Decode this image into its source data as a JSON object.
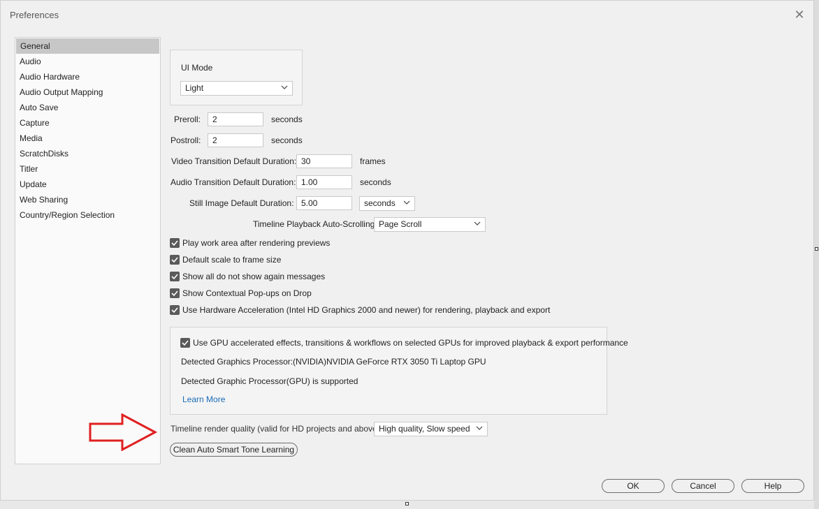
{
  "window": {
    "title": "Preferences",
    "close_glyph": "✕"
  },
  "sidebar": {
    "items": [
      {
        "label": "General",
        "selected": true
      },
      {
        "label": "Audio"
      },
      {
        "label": "Audio Hardware"
      },
      {
        "label": "Audio Output Mapping"
      },
      {
        "label": "Auto Save"
      },
      {
        "label": "Capture"
      },
      {
        "label": "Media"
      },
      {
        "label": "ScratchDisks"
      },
      {
        "label": "Titler"
      },
      {
        "label": "Update"
      },
      {
        "label": "Web Sharing"
      },
      {
        "label": "Country/Region Selection"
      }
    ]
  },
  "general": {
    "ui_mode": {
      "label": "UI Mode",
      "value": "Light"
    },
    "preroll": {
      "label": "Preroll:",
      "value": "2",
      "unit": "seconds"
    },
    "postroll": {
      "label": "Postroll:",
      "value": "2",
      "unit": "seconds"
    },
    "video_transition": {
      "label": "Video Transition Default Duration:",
      "value": "30",
      "unit": "frames"
    },
    "audio_transition": {
      "label": "Audio Transition Default Duration:",
      "value": "1.00",
      "unit": "seconds"
    },
    "still_image": {
      "label": "Still Image Default Duration:",
      "value": "5.00",
      "unit": "seconds"
    },
    "timeline_scroll": {
      "label": "Timeline Playback Auto-Scrolling:",
      "value": "Page Scroll"
    },
    "checkboxes": [
      {
        "label": "Play work area after rendering previews",
        "checked": true
      },
      {
        "label": "Default scale to frame size",
        "checked": true
      },
      {
        "label": "Show all do not show again messages",
        "checked": true
      },
      {
        "label": "Show Contextual Pop-ups on Drop",
        "checked": true
      },
      {
        "label": "Use Hardware Acceleration (Intel HD Graphics 2000 and newer) for rendering, playback and export",
        "checked": true
      }
    ],
    "gpu": {
      "checkbox_label": "Use GPU accelerated effects, transitions & workflows on selected GPUs for improved playback & export performance",
      "checked": true,
      "detected_label": "Detected Graphics Processor:",
      "detected_value": "(NVIDIA)NVIDIA GeForce RTX 3050 Ti Laptop GPU",
      "supported_text": "Detected Graphic Processor(GPU) is supported",
      "learn_more": "Learn More"
    },
    "render_quality": {
      "label": "Timeline render quality (valid for HD projects and above):",
      "value": "High quality, Slow speed"
    },
    "clean_button": "Clean Auto Smart Tone Learning"
  },
  "footer": {
    "ok": "OK",
    "cancel": "Cancel",
    "help": "Help"
  },
  "colors": {
    "arrow": "#e02020",
    "link": "#1a6bb8"
  },
  "icons": {
    "checkbox": "check-icon",
    "dropdown": "chevron-down-icon",
    "annotation": "red-arrow-icon"
  }
}
